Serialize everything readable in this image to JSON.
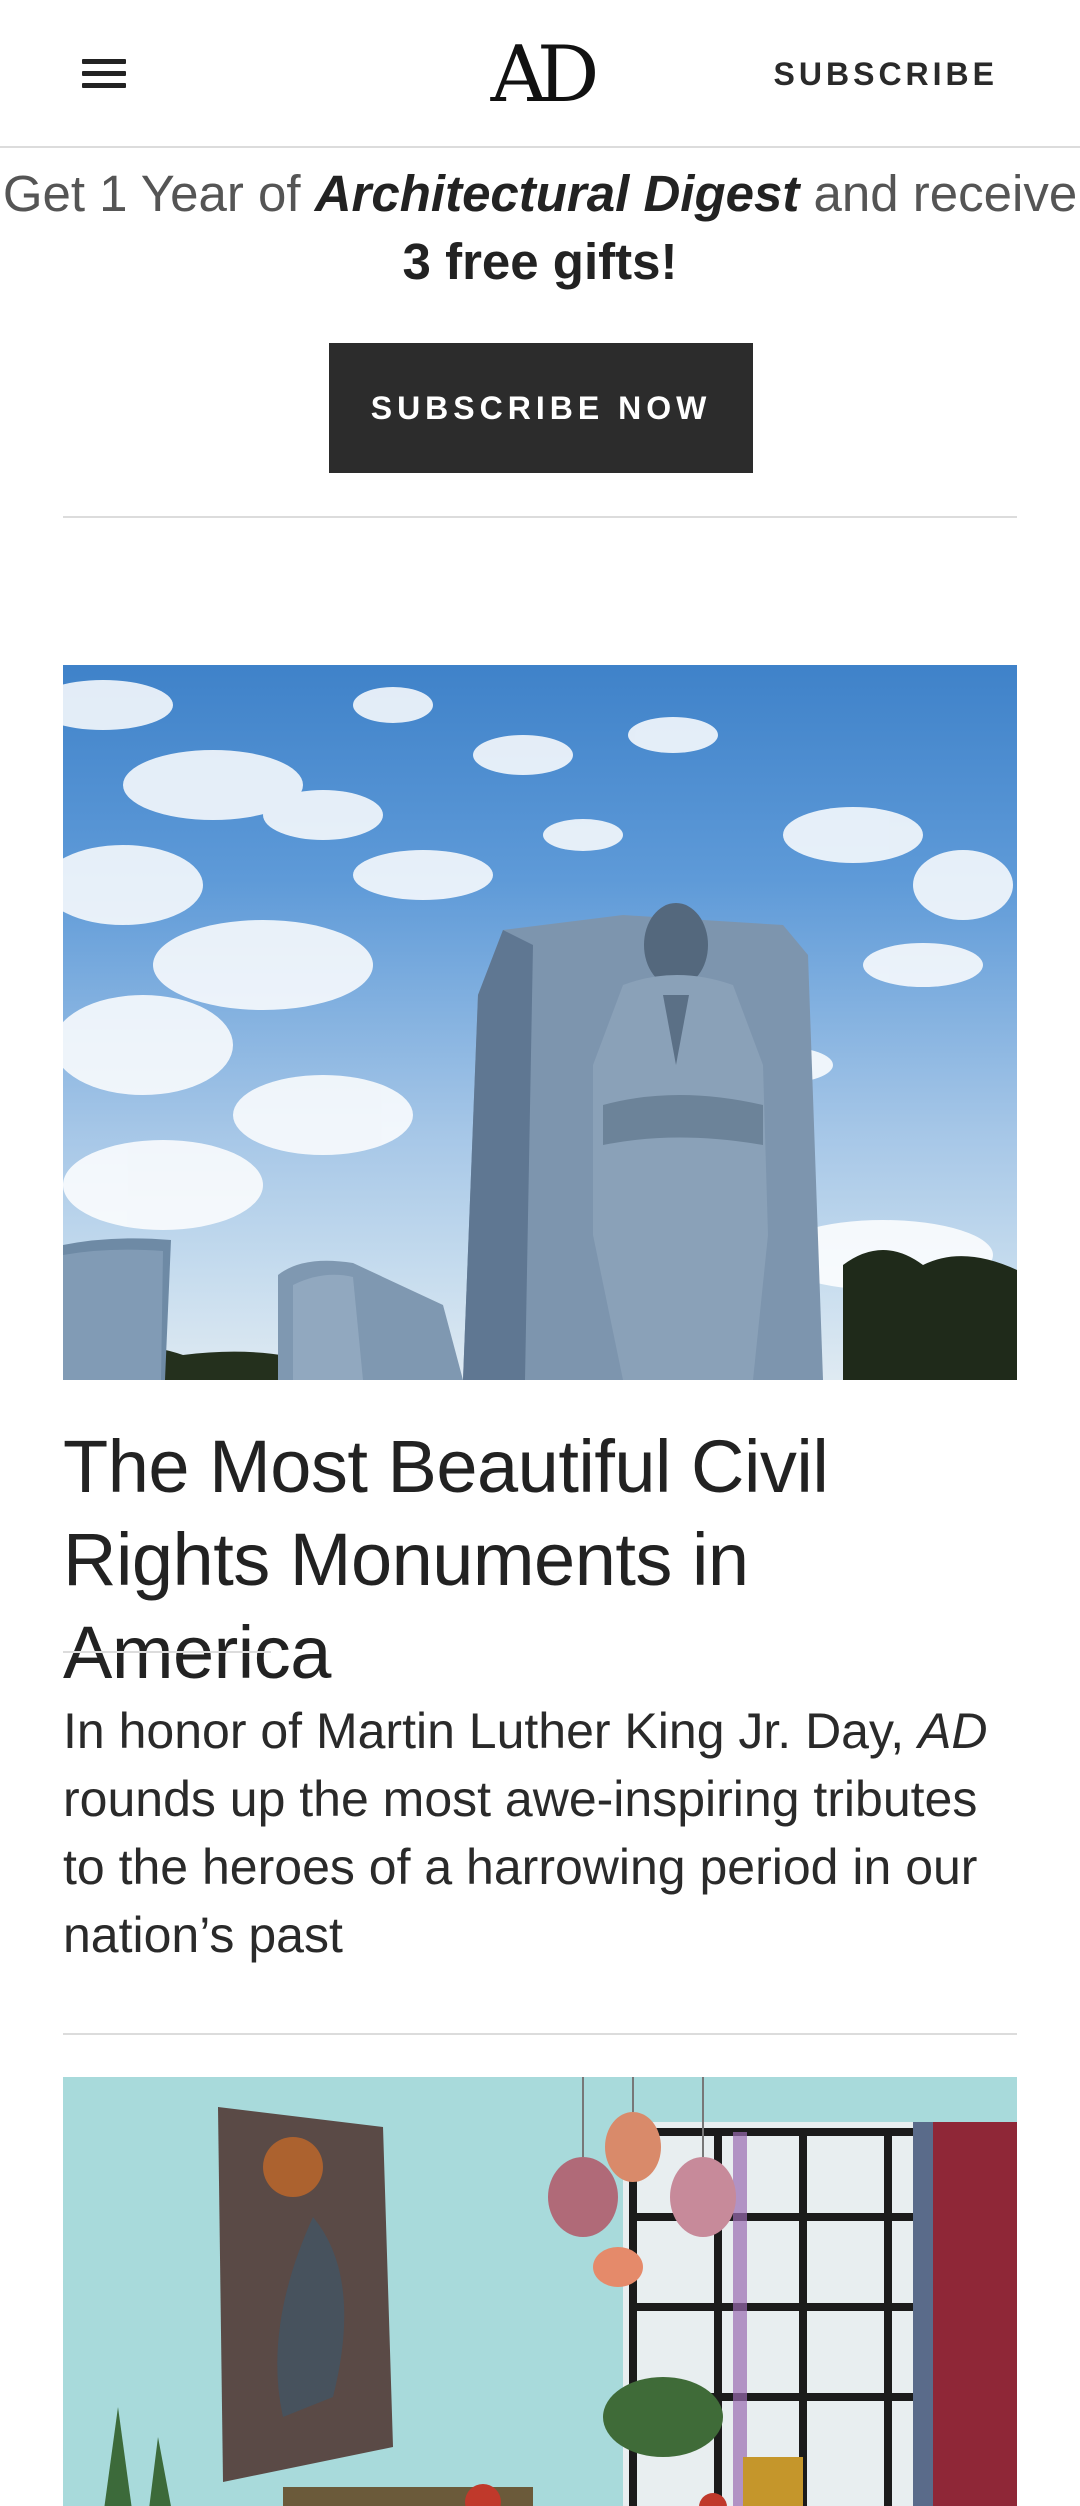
{
  "header": {
    "logo": "AD",
    "subscribe_label": "SUBSCRIBE"
  },
  "promo": {
    "prefix": "Get 1 Year of ",
    "magazine": "Architectural Digest",
    "middle": " and receive ",
    "gifts": "3 free gifts!",
    "button_label": "SUBSCRIBE NOW"
  },
  "article": {
    "headline": "The Most Beautiful Civil Rights Monuments in America",
    "dek_before": "In honor of Martin Luther King Jr. Day, ",
    "dek_italic": "AD",
    "dek_after": " rounds up the most awe-inspiring tributes to the heroes of a harrowing period in our nation’s past"
  },
  "icons": {
    "menu": "hamburger-menu-icon"
  },
  "colors": {
    "button_bg": "#2c2c2c",
    "text": "#222222",
    "divider": "#dcdcdc"
  }
}
